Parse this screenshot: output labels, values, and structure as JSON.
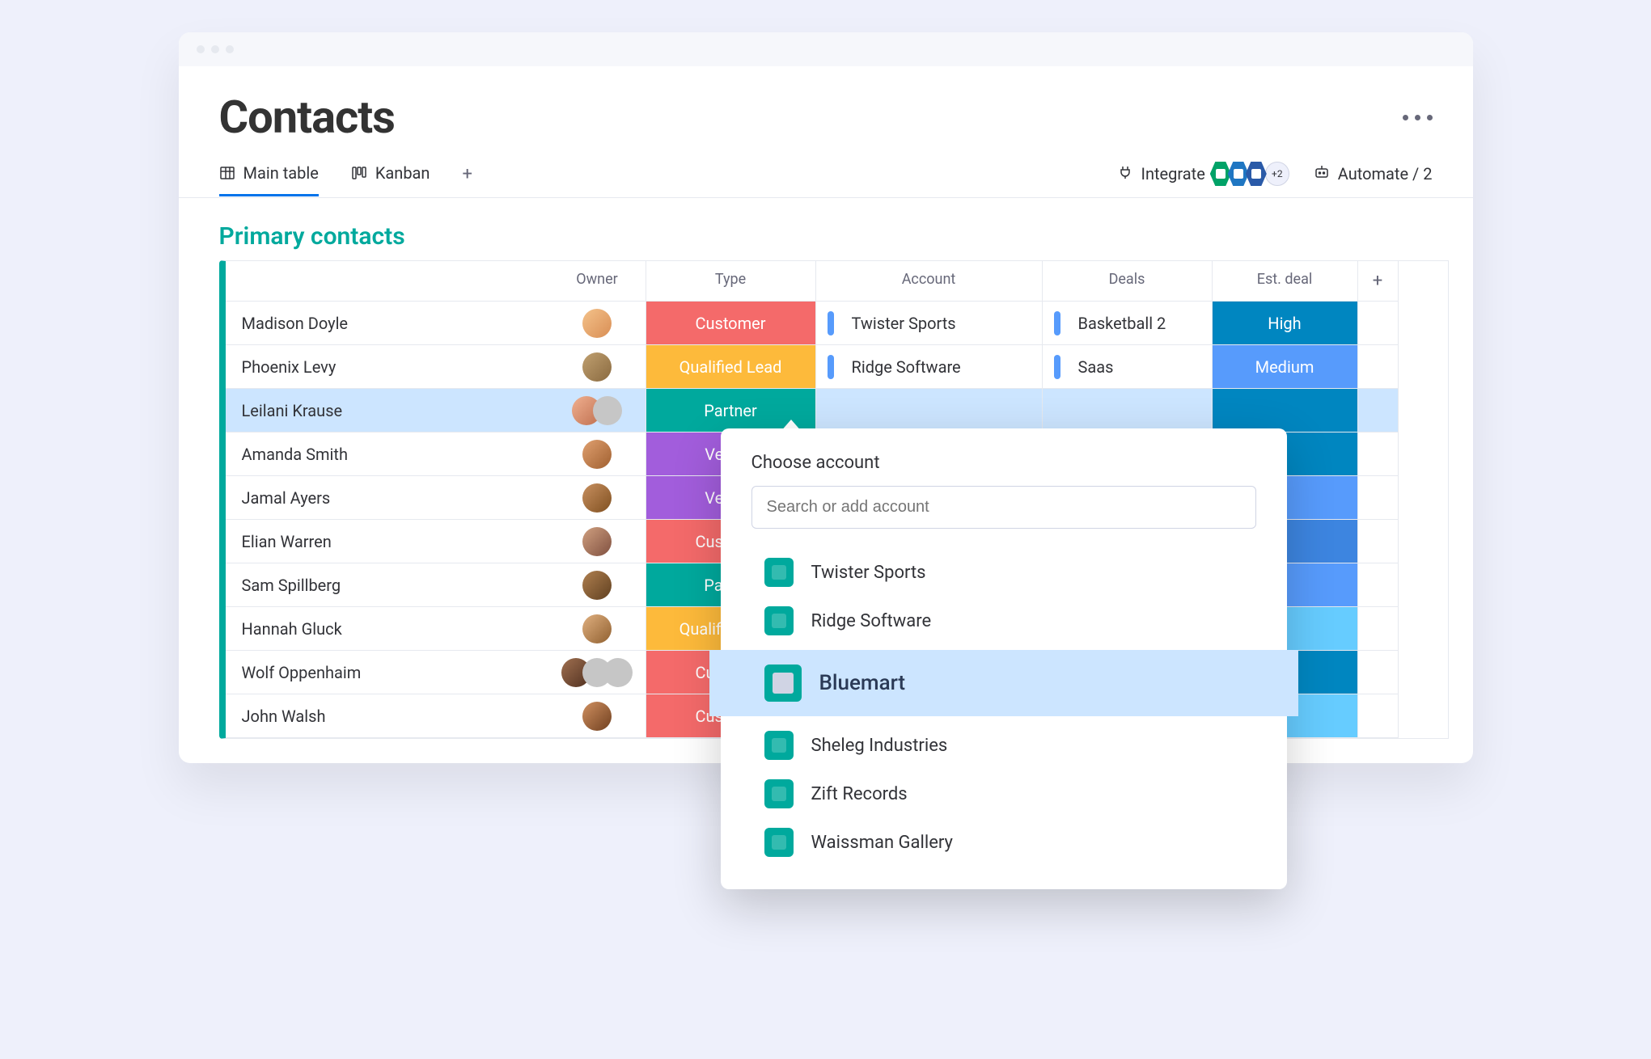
{
  "board": {
    "title": "Contacts"
  },
  "views": {
    "main": "Main table",
    "kanban": "Kanban",
    "integrate": "Integrate",
    "int_more": "+2",
    "automate": "Automate / 2"
  },
  "group": {
    "title": "Primary contacts"
  },
  "columns": {
    "owner": "Owner",
    "type": "Type",
    "account": "Account",
    "deals": "Deals",
    "est": "Est. deal",
    "add": "+"
  },
  "rows": [
    {
      "name": "Madison Doyle",
      "type": "Customer",
      "type_cls": "t-customer",
      "account": "Twister Sports",
      "deals": "Basketball 2",
      "est": "High",
      "est_cls": "e-high"
    },
    {
      "name": "Phoenix Levy",
      "type": "Qualified Lead",
      "type_cls": "t-qlead",
      "account": "Ridge Software",
      "deals": "Saas",
      "est": "Medium",
      "est_cls": "e-medium"
    },
    {
      "name": "Leilani Krause",
      "type": "Partner",
      "type_cls": "t-partner",
      "account": "",
      "deals": "",
      "est": "",
      "est_cls": "e-high2",
      "selected": true,
      "arrow": true,
      "avatars": 2
    },
    {
      "name": "Amanda Smith",
      "type": "Vendor",
      "type_cls": "t-vendor",
      "account": "",
      "deals": "",
      "est": "",
      "est_cls": "e-high2"
    },
    {
      "name": "Jamal Ayers",
      "type": "Vendor",
      "type_cls": "t-vendor",
      "account": "",
      "deals": "",
      "est": "",
      "est_cls": "e-blue3"
    },
    {
      "name": "Elian Warren",
      "type": "Customer",
      "type_cls": "t-customer",
      "account": "",
      "deals": "",
      "est": "",
      "est_cls": "e-blue4"
    },
    {
      "name": "Sam Spillberg",
      "type": "Partner",
      "type_cls": "t-partner",
      "account": "",
      "deals": "",
      "est": "",
      "est_cls": "e-blue3"
    },
    {
      "name": "Hannah Gluck",
      "type": "Qualified Lead",
      "type_cls": "t-qlead",
      "account": "",
      "deals": "",
      "est": "",
      "est_cls": "e-cyan"
    },
    {
      "name": "Wolf Oppenhaim",
      "type": "Customer",
      "type_cls": "t-customer",
      "account": "",
      "deals": "",
      "est": "",
      "est_cls": "e-dark",
      "avatars": 3
    },
    {
      "name": "John Walsh",
      "type": "Customer",
      "type_cls": "t-customer",
      "account": "",
      "deals": "",
      "est": "",
      "est_cls": "e-cyan"
    }
  ],
  "popover": {
    "title": "Choose account",
    "placeholder": "Search or add account",
    "options": [
      "Twister Sports",
      "Ridge Software",
      "Bluemart",
      "Sheleg Industries",
      "Zift Records",
      "Waissman Gallery"
    ],
    "selected": "Bluemart"
  }
}
